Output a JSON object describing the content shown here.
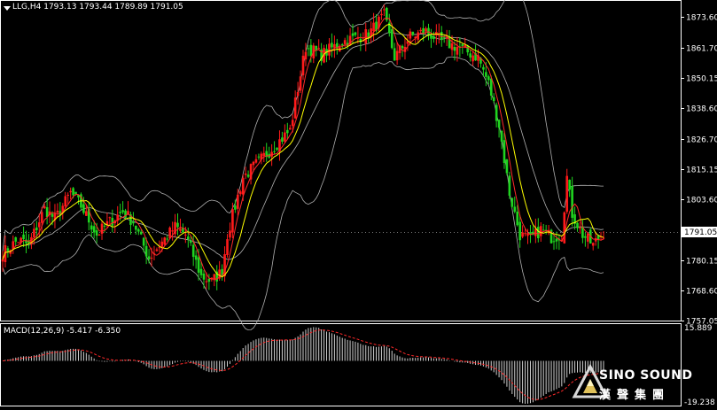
{
  "header": {
    "symbol": "LLG,H4",
    "open": "1793.13",
    "high": "1793.44",
    "low": "1789.89",
    "close": "1791.05"
  },
  "macd_header": {
    "label": "MACD(12,26,9)",
    "macd": "-5.417",
    "signal": "-6.350"
  },
  "colors": {
    "bull": "#ff1a1a",
    "bear": "#1fd41f",
    "ma_fast": "#ff2a2a",
    "ma_slow": "#ffff00",
    "bands": "#b0b0b0",
    "axis": "#ffffff",
    "grid": "#ffffff"
  },
  "logo": {
    "english": "SINO SOUND",
    "chinese": "漢聲集團"
  },
  "chart_data": [
    {
      "type": "candlestick",
      "title": "",
      "price_axis_ticks": [
        "1873.60",
        "1861.70",
        "1850.15",
        "1838.60",
        "1826.70",
        "1815.15",
        "1803.60",
        "1791.05",
        "1780.15",
        "1768.60",
        "1757.05"
      ],
      "current_price": "1791.05",
      "ylim": [
        1757.05,
        1880
      ],
      "close_path": [
        [
          0,
          1783
        ],
        [
          6,
          1788
        ],
        [
          10,
          1786
        ],
        [
          16,
          1800
        ],
        [
          20,
          1796
        ],
        [
          26,
          1806
        ],
        [
          30,
          1801
        ],
        [
          36,
          1790
        ],
        [
          40,
          1794
        ],
        [
          46,
          1799
        ],
        [
          50,
          1795
        ],
        [
          56,
          1781
        ],
        [
          60,
          1786
        ],
        [
          66,
          1793
        ],
        [
          70,
          1790
        ],
        [
          76,
          1774
        ],
        [
          80,
          1772
        ],
        [
          84,
          1776
        ],
        [
          86,
          1790
        ],
        [
          92,
          1812
        ],
        [
          100,
          1820
        ],
        [
          106,
          1826
        ],
        [
          110,
          1830
        ],
        [
          116,
          1862
        ],
        [
          122,
          1859
        ],
        [
          130,
          1864
        ],
        [
          140,
          1867
        ],
        [
          146,
          1874
        ],
        [
          150,
          1858
        ],
        [
          156,
          1866
        ],
        [
          162,
          1868
        ],
        [
          168,
          1864
        ],
        [
          174,
          1862
        ],
        [
          182,
          1858
        ],
        [
          186,
          1848
        ],
        [
          190,
          1832
        ],
        [
          194,
          1806
        ],
        [
          198,
          1790
        ],
        [
          202,
          1788
        ],
        [
          206,
          1792
        ],
        [
          210,
          1789
        ],
        [
          214,
          1790
        ],
        [
          216,
          1812
        ],
        [
          218,
          1798
        ],
        [
          222,
          1790
        ],
        [
          226,
          1786
        ],
        [
          230,
          1791
        ]
      ],
      "overlays": [
        "moving_average_fast",
        "moving_average_slow",
        "bollinger_bands"
      ]
    },
    {
      "type": "bar",
      "title": "MACD(12,26,9)",
      "axis_ticks": [
        "15.889",
        "-19.238"
      ],
      "macd_value": -5.417,
      "signal_value": -6.35,
      "ylim": [
        -19.238,
        15.889
      ]
    }
  ]
}
